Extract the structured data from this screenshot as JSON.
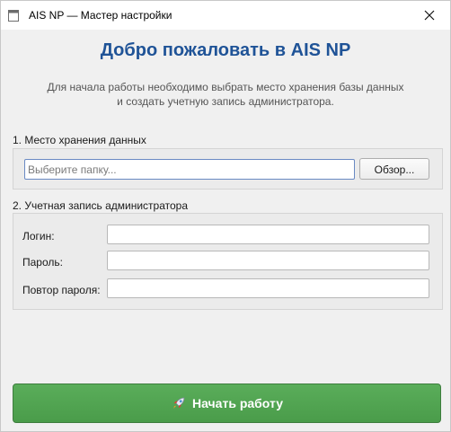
{
  "window": {
    "title": "AIS NP — Мастер настройки",
    "icons": {
      "app": "app-window-icon",
      "close": "close-icon"
    }
  },
  "header": {
    "title": "Добро пожаловать в AIS NP",
    "subtitle_line1": "Для начала работы необходимо выбрать место хранения базы данных",
    "subtitle_line2": "и создать учетную запись администратора.",
    "title_color": "#1f5397"
  },
  "storage": {
    "section_label": "1. Место хранения данных",
    "path_value": "",
    "path_placeholder": "Выберите папку...",
    "browse_label": "Обзор..."
  },
  "admin": {
    "section_label": "2. Учетная запись администратора",
    "fields": [
      {
        "label": "Логин:",
        "value": ""
      },
      {
        "label": "Пароль:",
        "value": ""
      },
      {
        "label": "Повтор пароля:",
        "value": ""
      }
    ]
  },
  "actions": {
    "start_label": "Начать работу",
    "start_icon": "rocket-icon",
    "accent_color": "#4fa34f"
  }
}
